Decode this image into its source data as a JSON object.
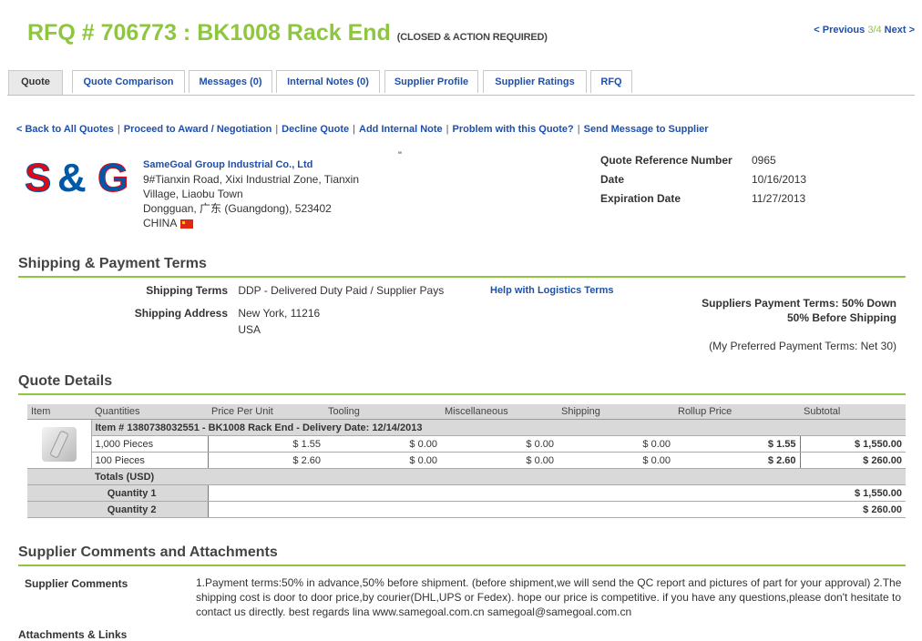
{
  "header": {
    "title": "RFQ # 706773 : BK1008 Rack End",
    "status": "(CLOSED & ACTION REQUIRED)",
    "prev": "< Previous",
    "position": "3/4",
    "next": "Next >"
  },
  "tabs": [
    "Quote",
    "Quote Comparison",
    "Messages (0)",
    "Internal Notes (0)",
    "Supplier Profile",
    "Supplier Ratings",
    "RFQ"
  ],
  "actions": [
    "< Back to All Quotes",
    "Proceed to Award / Negotiation",
    "Decline Quote",
    "Add Internal Note",
    "Problem with this Quote?",
    "Send Message to Supplier"
  ],
  "supplier": {
    "logo_text": "S&G",
    "name": "SameGoal Group Industrial Co., Ltd",
    "address1": "9#Tianxin Road, Xixi Industrial Zone, Tianxin",
    "address2": "Village, Liaobu Town",
    "address3": "Dongguan, 广东 (Guangdong), 523402",
    "country": "CHINA",
    "quote_mark": "\""
  },
  "quote_meta": {
    "ref_label": "Quote Reference Number",
    "ref_value": "0965",
    "date_label": "Date",
    "date_value": "10/16/2013",
    "exp_label": "Expiration Date",
    "exp_value": "11/27/2013"
  },
  "shipping": {
    "heading": "Shipping & Payment Terms",
    "terms_label": "Shipping Terms",
    "terms_value": "DDP - Delivered Duty Paid / Supplier Pays",
    "help_link": "Help with Logistics Terms",
    "address_label": "Shipping Address",
    "address_line1": "New York, 11216",
    "address_line2": "USA",
    "payment_line1": "Suppliers Payment Terms: 50% Down",
    "payment_line2": "50% Before Shipping",
    "preferred": "(My Preferred Payment Terms: Net 30)"
  },
  "quote_details": {
    "heading": "Quote Details",
    "columns": [
      "Item",
      "Quantities",
      "Price Per Unit",
      "Tooling",
      "Miscellaneous",
      "Shipping",
      "Rollup Price",
      "Subtotal"
    ],
    "item_line": "Item # 1380738032551 - BK1008 Rack End - Delivery Date: 12/14/2013",
    "rows": [
      {
        "qty": "1,000 Pieces",
        "ppu": "$ 1.55",
        "tooling": "$ 0.00",
        "misc": "$ 0.00",
        "ship": "$ 0.00",
        "rollup": "$ 1.55",
        "subtotal": "$ 1,550.00"
      },
      {
        "qty": "100 Pieces",
        "ppu": "$ 2.60",
        "tooling": "$ 0.00",
        "misc": "$ 0.00",
        "ship": "$ 0.00",
        "rollup": "$ 2.60",
        "subtotal": "$ 260.00"
      }
    ],
    "totals_label": "Totals (USD)",
    "q1_label": "Quantity 1",
    "q1_value": "$ 1,550.00",
    "q2_label": "Quantity 2",
    "q2_value": "$ 260.00"
  },
  "comments": {
    "heading": "Supplier Comments and Attachments",
    "label": "Supplier Comments",
    "text": "1.Payment terms:50% in advance,50% before shipment. (before shipment,we will send the QC report and pictures of part for your approval) 2.The shipping cost is door to door price,by courier(DHL,UPS or Fedex). hope our price is competitive. if you have any questions,please don't hesitate to contact us directly. best regards lina www.samegoal.com.cn samegoal@samegoal.com.cn",
    "attachments_label": "Attachments & Links"
  },
  "colors": {
    "accent_green": "#8ec63f",
    "link_blue": "#1f4fa8",
    "logo_red": "#e30613",
    "logo_blue": "#0058a8"
  }
}
